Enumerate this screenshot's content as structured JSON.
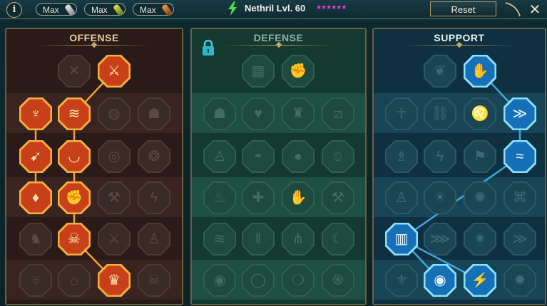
{
  "header": {
    "info_label": "i",
    "max_buttons": [
      {
        "label": "Max",
        "vial_color": "#c8c8c8"
      },
      {
        "label": "Max",
        "vial_color": "#b8c040"
      },
      {
        "label": "Max",
        "vial_color": "#d88030"
      }
    ],
    "hero_name": "Nethril Lvl. 60",
    "stars": "★★★★★★",
    "reset_label": "Reset",
    "close_label": "✕"
  },
  "panels": {
    "offense": {
      "title": "OFFENSE",
      "accent": "#f0a030"
    },
    "defense": {
      "title": "DEFENSE",
      "locked": true
    },
    "support": {
      "title": "SUPPORT",
      "accent": "#3aa8e0"
    }
  },
  "nodes": {
    "offense": [
      {
        "name": "blade-strike-icon",
        "state": "locked",
        "glyph": "✕"
      },
      {
        "name": "slash-burst-icon",
        "state": "active",
        "glyph": "⚔"
      },
      {
        "name": "demon-warrior-icon",
        "state": "active",
        "glyph": "♆"
      },
      {
        "name": "triple-slash-icon",
        "state": "active",
        "glyph": "≋"
      },
      {
        "name": "mask-icon",
        "state": "locked",
        "glyph": "◍"
      },
      {
        "name": "skull-helm-icon",
        "state": "locked",
        "glyph": "☗"
      },
      {
        "name": "arrow-hit-icon",
        "state": "active",
        "glyph": "➹"
      },
      {
        "name": "fangs-icon",
        "state": "active",
        "glyph": "◡"
      },
      {
        "name": "spiral-icon",
        "state": "locked",
        "glyph": "◎"
      },
      {
        "name": "swirl-icon",
        "state": "locked",
        "glyph": "❂"
      },
      {
        "name": "blood-drop-icon",
        "state": "active",
        "glyph": "♦"
      },
      {
        "name": "fist-icon",
        "state": "active",
        "glyph": "✊"
      },
      {
        "name": "axe-icon",
        "state": "locked",
        "glyph": "⚒"
      },
      {
        "name": "lightning-icon",
        "state": "locked",
        "glyph": "ϟ"
      },
      {
        "name": "beast-icon",
        "state": "locked",
        "glyph": "♞"
      },
      {
        "name": "triple-skull-icon",
        "state": "active",
        "glyph": "☠"
      },
      {
        "name": "swords-icon",
        "state": "locked",
        "glyph": "⚔"
      },
      {
        "name": "figure-icon",
        "state": "locked",
        "glyph": "♙"
      },
      {
        "name": "horned-demon-icon",
        "state": "locked",
        "glyph": "♅"
      },
      {
        "name": "cage-helm-icon",
        "state": "locked",
        "glyph": "⌂"
      },
      {
        "name": "demon-lord-icon",
        "state": "active",
        "glyph": "♛"
      },
      {
        "name": "skull-icon",
        "state": "locked",
        "glyph": "☠"
      }
    ],
    "defense": [
      {
        "name": "shield-grid-icon",
        "state": "locked",
        "glyph": "▦"
      },
      {
        "name": "fist-shield-icon",
        "state": "locked",
        "glyph": "✊"
      },
      {
        "name": "cloak-icon",
        "state": "locked",
        "glyph": "☗"
      },
      {
        "name": "heart-shield-icon",
        "state": "locked",
        "glyph": "♥"
      },
      {
        "name": "tower-icon",
        "state": "locked",
        "glyph": "♜"
      },
      {
        "name": "slash-guard-icon",
        "state": "locked",
        "glyph": "⧄"
      },
      {
        "name": "warrior-icon",
        "state": "locked",
        "glyph": "♙"
      },
      {
        "name": "helm-icon",
        "state": "locked",
        "glyph": "◓"
      },
      {
        "name": "bomb-icon",
        "state": "locked",
        "glyph": "●"
      },
      {
        "name": "face-icon",
        "state": "locked",
        "glyph": "☺"
      },
      {
        "name": "flame-hand-icon",
        "state": "locked",
        "glyph": "♨"
      },
      {
        "name": "cross-icon",
        "state": "locked",
        "glyph": "✚"
      },
      {
        "name": "palm-icon",
        "state": "locked",
        "glyph": "✋"
      },
      {
        "name": "cleaver-icon",
        "state": "locked",
        "glyph": "⚒"
      },
      {
        "name": "wind-icon",
        "state": "locked",
        "glyph": "≋"
      },
      {
        "name": "pillar-icon",
        "state": "locked",
        "glyph": "‖"
      },
      {
        "name": "tri-blade-icon",
        "state": "locked",
        "glyph": "⋔"
      },
      {
        "name": "crescent-icon",
        "state": "locked",
        "glyph": "☾"
      },
      {
        "name": "heal-orb-icon",
        "state": "locked",
        "glyph": "◉"
      },
      {
        "name": "ring-icon",
        "state": "locked",
        "glyph": "◯"
      },
      {
        "name": "bubble-icon",
        "state": "locked",
        "glyph": "❍"
      },
      {
        "name": "spiral-shield-icon",
        "state": "locked",
        "glyph": "֍"
      }
    ],
    "support": [
      {
        "name": "leaf-icon",
        "state": "locked",
        "glyph": "❦"
      },
      {
        "name": "spirit-hand-icon",
        "state": "active",
        "glyph": "✋"
      },
      {
        "name": "praying-hands-icon",
        "state": "locked",
        "glyph": "☥"
      },
      {
        "name": "chain-icon",
        "state": "locked",
        "glyph": "⛓"
      },
      {
        "name": "lion-icon",
        "state": "locked",
        "glyph": "♌"
      },
      {
        "name": "dash-icon",
        "state": "active",
        "glyph": "≫"
      },
      {
        "name": "mage-icon",
        "state": "locked",
        "glyph": "♗"
      },
      {
        "name": "storm-icon",
        "state": "locked",
        "glyph": "ϟ"
      },
      {
        "name": "banner-icon",
        "state": "locked",
        "glyph": "⚑"
      },
      {
        "name": "energy-wave-icon",
        "state": "active",
        "glyph": "≈"
      },
      {
        "name": "monk-icon",
        "state": "locked",
        "glyph": "♙"
      },
      {
        "name": "sun-icon",
        "state": "locked",
        "glyph": "☀"
      },
      {
        "name": "hand-burst-icon",
        "state": "locked",
        "glyph": "✺"
      },
      {
        "name": "scroll-icon",
        "state": "locked",
        "glyph": "⌘"
      },
      {
        "name": "spellbook-icon",
        "state": "active",
        "glyph": "▥"
      },
      {
        "name": "claw-icon",
        "state": "locked",
        "glyph": "⋙"
      },
      {
        "name": "starburst-icon",
        "state": "locked",
        "glyph": "✷"
      },
      {
        "name": "speed-boot-icon",
        "state": "locked",
        "glyph": "≫"
      },
      {
        "name": "winged-helm-icon",
        "state": "locked",
        "glyph": "⚜"
      },
      {
        "name": "eye-icon",
        "state": "active",
        "glyph": "◉"
      },
      {
        "name": "fallen-warrior-icon",
        "state": "active",
        "glyph": "⚡"
      },
      {
        "name": "sunflare-icon",
        "state": "locked",
        "glyph": "✹"
      },
      {
        "name": "pinwheel-icon",
        "state": "locked",
        "glyph": "✲"
      },
      {
        "name": "hermit-icon",
        "state": "locked",
        "glyph": "♗"
      },
      {
        "name": "wing-icon",
        "state": "locked",
        "glyph": "⌒"
      },
      {
        "name": "bowl-icon",
        "state": "locked",
        "glyph": "◡"
      },
      {
        "name": "skull2-icon",
        "state": "locked",
        "glyph": "☠"
      }
    ]
  }
}
